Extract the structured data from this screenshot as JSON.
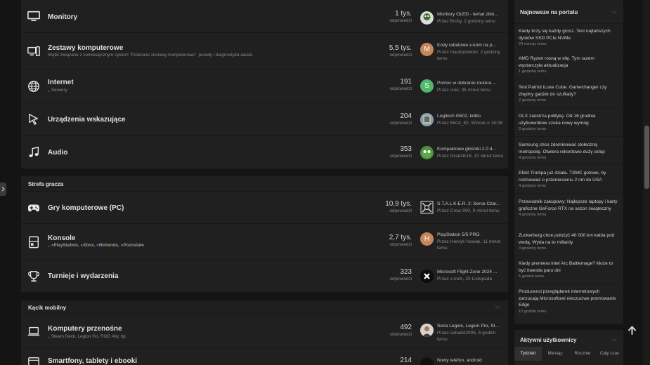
{
  "forums": [
    {
      "title": "Monitory",
      "count": "1 tys.",
      "count_label": "odpowiedzi",
      "last_title": "Monitory OLED - temat zbio...",
      "last_meta": "Przez Brolly, 2 godziny temu"
    },
    {
      "title": "Zestawy komputerowe",
      "desc": "Wątki związane z comiesięcznym cyklem \"Polecane zestawy komputerowe\", porady i diagnostyka awarii.",
      "count": "5,5 tys.",
      "count_label": "odpowiedzi",
      "avatar_letter": "M",
      "last_title": "Kody rabatowe x-kom na p...",
      "last_meta": "Przez maxtipsbetter, 2 godziny temu"
    },
    {
      "title": "Internet",
      "sub": "Serwery",
      "count": "191",
      "count_label": "odpowiedzi",
      "avatar_letter": "S",
      "last_title": "Pomoc w dobraniu routera ...",
      "last_meta": "Przez sino, 35 minut temu"
    },
    {
      "title": "Urządzenia wskazujące",
      "count": "204",
      "count_label": "odpowiedzi",
      "last_title": "Logitech G502, kółko",
      "last_meta": "Przez Miczi_82, Wtorek o 18:08"
    },
    {
      "title": "Audio",
      "count": "353",
      "count_label": "odpowiedzi",
      "last_title": "Kompaktowe głośniki 2.0 d...",
      "last_meta": "Przez Gradzik18, 10 minut temu"
    }
  ],
  "gamer": {
    "heading": "Strefa gracza",
    "forums": [
      {
        "title": "Gry komputerowe (PC)",
        "count": "10,9 tys.",
        "count_label": "odpowiedzi",
        "last_title": "S.T.A.L.K.E.R. 2: Serce Czar...",
        "last_meta": "Przez Crew 900, 9 minut temu"
      },
      {
        "title": "Konsole",
        "subs": [
          "PlayStation,",
          "Xbox,",
          "Nintendo,",
          "Pozostałe"
        ],
        "count": "2,7 tys.",
        "count_label": "odpowiedzi",
        "avatar_letter": "H",
        "last_title": "PlayStation 5/5 PRO",
        "last_meta": "Przez Henryk Nowak, 11 minut temu"
      },
      {
        "title": "Turnieje i wydarzenia",
        "count": "323",
        "count_label": "odpowiedzi",
        "last_title": "Microsoft Flight Zone 2024 ...",
        "last_meta": "Przez x-kom, 20 Listopada"
      }
    ]
  },
  "mobile": {
    "heading": "Kącik mobilny",
    "forums": [
      {
        "title": "Komputery przenośne",
        "sub": "Steam Deck, Legion Go, ROG Ally, itp.",
        "count": "492",
        "count_label": "odpowiedzi",
        "last_title": "Seria Legion, Legion Pro, SI...",
        "last_meta": "Przez seba842005, 6 godzin temu"
      },
      {
        "title": "Smartfony, tablety i ebooki",
        "count": "214",
        "last_title": "Nowy telefon, android"
      }
    ]
  },
  "sidebar": {
    "news_heading": "Najnowsze na portalu",
    "news": [
      {
        "title": "Kiedy liczy się każdy grosz. Test najtańszych dysków SSD PCIe NVMe",
        "time": "24 minuty temu"
      },
      {
        "title": "AMD Ryzen rosną w siłę. Tym razem wystarczyła aktualizacja",
        "time": "1 godzinę temu"
      },
      {
        "title": "Test Patriot iLuxe Cube. Gamechanger czy zbędny gadżet do szuflady?",
        "time": "2 godziny temu"
      },
      {
        "title": "OLX zaostrza politykę. Od 16 grudnia użytkowników czeka nowy wymóg",
        "time": "3 godziny temu"
      },
      {
        "title": "Samsung chce zdominować stołeczną metropolię. Otwiera rekordowo duży sklep",
        "time": "4 godziny temu"
      },
      {
        "title": "Efekt Trumpa już działa. TSMC gotowe, by rozmawiać o przeniesieniu 2 nm do USA",
        "time": "4 godziny temu"
      },
      {
        "title": "Przewodnik zakupowy: Najlepsze laptopy i karty graficzne GeForce RTX na sezon świąteczny",
        "time": "4 godziny temu"
      },
      {
        "title": "Zuckerberg chce położyć 40 000 km kabla pod wodą. Wyda na to miliardy",
        "time": "4 godziny temu"
      },
      {
        "title": "Kiedy premiera Intel Arc Battlemage? Może to być kwestia paru dni",
        "time": "5 godzin temu"
      },
      {
        "title": "Producenci przeglądarek internetowych zarzucają Microsoftowi nieczuciwe promowanie Edge",
        "time": "15 godzin temu"
      }
    ],
    "active_heading": "Aktywni użytkownicy",
    "tabs": [
      "Tydzień",
      "Miesiąc",
      "Rocznie",
      "Cały czas"
    ]
  },
  "colors": {
    "sub_dot": "#3b7fd4",
    "background": "#141414",
    "panel": "#202020"
  }
}
